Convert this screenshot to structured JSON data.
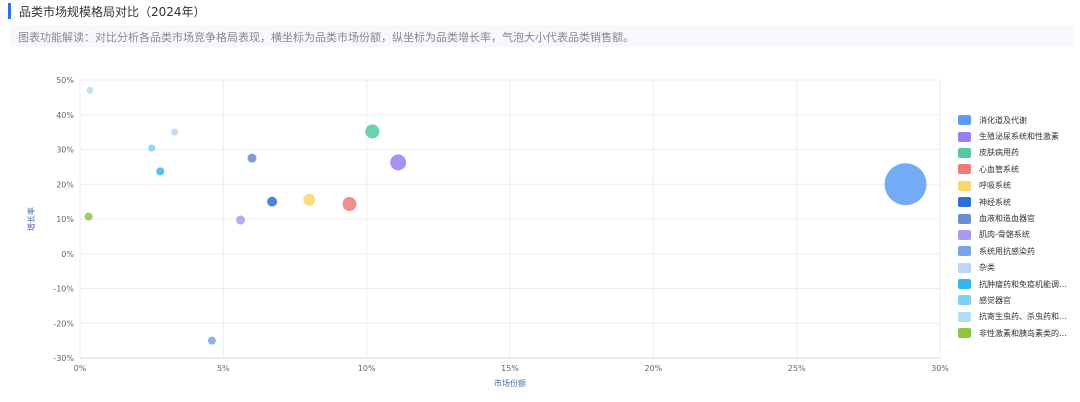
{
  "header": {
    "title": "品类市场规模格局对比（2024年）",
    "description": "图表功能解读：对比分析各品类市场竞争格局表现，横坐标为品类市场份额，纵坐标为品类增长率，气泡大小代表品类销售额。"
  },
  "chart_data": {
    "type": "scatter",
    "xlabel": "市场份额",
    "ylabel": "增长率",
    "xlim": [
      0,
      30
    ],
    "ylim": [
      -30,
      50
    ],
    "x_ticks": [
      "0%",
      "5%",
      "10%",
      "15%",
      "20%",
      "25%",
      "30%"
    ],
    "y_ticks": [
      "50%",
      "40%",
      "30%",
      "20%",
      "10%",
      "0%",
      "-10%",
      "-20%",
      "-30%"
    ],
    "grid": true,
    "legend_position": "right",
    "series": [
      {
        "name": "消化道及代谢",
        "color": "#5b9cf6",
        "x": 28.8,
        "y": 20.0,
        "size": 21
      },
      {
        "name": "生殖泌尿系统和性激素",
        "color": "#9a7ef2",
        "x": 11.1,
        "y": 26.3,
        "size": 8
      },
      {
        "name": "皮肤病用药",
        "color": "#52c9a0",
        "x": 10.2,
        "y": 35.2,
        "size": 7
      },
      {
        "name": "心血管系统",
        "color": "#ef7b7b",
        "x": 9.4,
        "y": 14.3,
        "size": 7
      },
      {
        "name": "呼吸系统",
        "color": "#fbd66b",
        "x": 8.0,
        "y": 15.5,
        "size": 6
      },
      {
        "name": "神经系统",
        "color": "#2e6fdb",
        "x": 6.7,
        "y": 15.0,
        "size": 5
      },
      {
        "name": "血液和造血器官",
        "color": "#6d8bd0",
        "x": 6.0,
        "y": 27.5,
        "size": 4.5
      },
      {
        "name": "肌肉-骨骼系统",
        "color": "#a89cf0",
        "x": 5.6,
        "y": 9.7,
        "size": 4.5
      },
      {
        "name": "系统用抗感染药",
        "color": "#7ba4e8",
        "x": 4.6,
        "y": -25.0,
        "size": 4
      },
      {
        "name": "杂类",
        "color": "#bcd6f5",
        "x": 3.3,
        "y": 35.0,
        "size": 3.5
      },
      {
        "name": "抗肿瘤药和免疫机能调节剂",
        "color": "#36b6f0",
        "x": 2.8,
        "y": 23.7,
        "size": 4
      },
      {
        "name": "感觉器官",
        "color": "#7fcff6",
        "x": 2.5,
        "y": 30.4,
        "size": 3.5
      },
      {
        "name": "抗寄生虫药、杀虫药和驱虫药",
        "color": "#b5dcf0",
        "x": 0.35,
        "y": 47.0,
        "size": 3.5
      },
      {
        "name": "非性激素和胰岛素类的激素类系统用药",
        "color": "#8cc63f",
        "x": 0.3,
        "y": 10.7,
        "size": 4
      }
    ]
  }
}
